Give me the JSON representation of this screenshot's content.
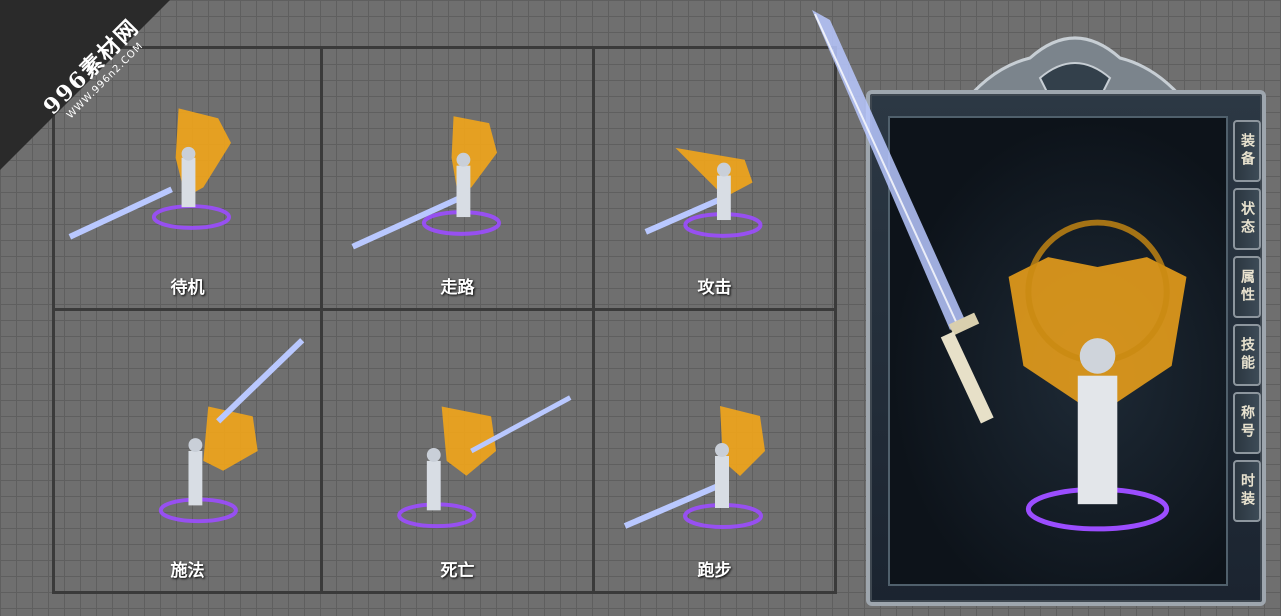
{
  "watermark": {
    "brand": "996素材网",
    "url": "WWW.996n2.COM"
  },
  "animation_states": [
    {
      "label": "待机"
    },
    {
      "label": "走路"
    },
    {
      "label": "攻击"
    },
    {
      "label": "施法"
    },
    {
      "label": "死亡"
    },
    {
      "label": "跑步"
    }
  ],
  "panel": {
    "tabs": [
      "装备",
      "状态",
      "属性",
      "技能",
      "称号",
      "时装"
    ]
  },
  "colors": {
    "background": "#6f6f6f",
    "wing": "#f2a51a",
    "blade": "#b9c8ff",
    "aura": "#9b4dff",
    "frame": "#9ea6ae"
  }
}
